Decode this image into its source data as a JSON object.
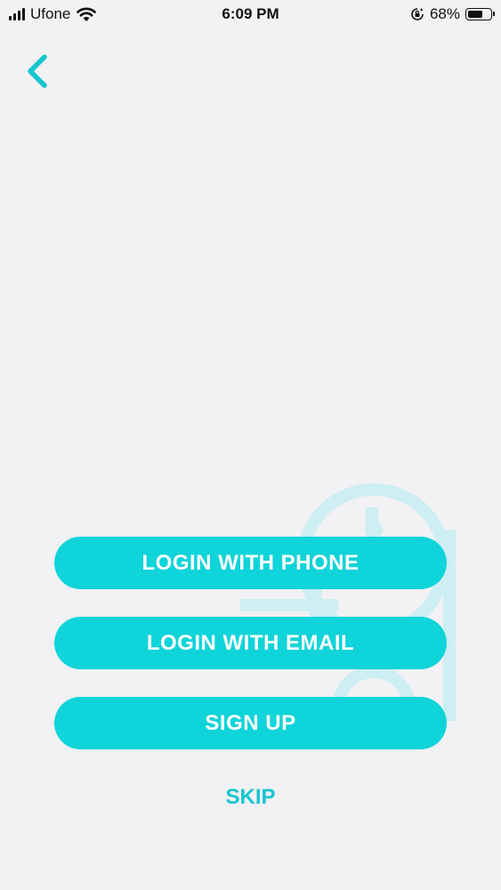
{
  "status_bar": {
    "carrier": "Ufone",
    "time": "6:09 PM",
    "battery_percent": "68%",
    "battery_level": 0.68,
    "signal_bars_filled": 4
  },
  "nav": {
    "back_icon": "chevron-left-icon"
  },
  "actions": {
    "login_phone": "LOGIN WITH PHONE",
    "login_email": "LOGIN WITH EMAIL",
    "sign_up": "SIGN UP",
    "skip": "SKIP"
  },
  "colors": {
    "accent": "#0fd4d9",
    "skip_text": "#14c6cf",
    "background": "#f2f1f3",
    "watermark": "#c9eef2"
  }
}
